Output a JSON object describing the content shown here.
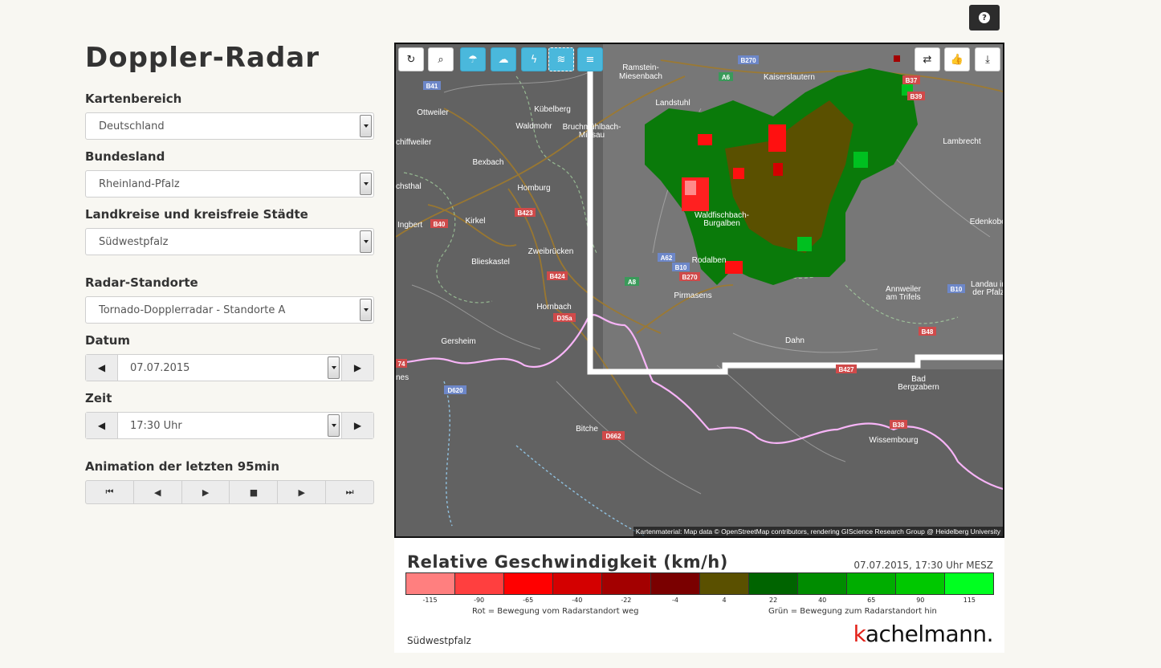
{
  "page": {
    "title": "Doppler-Radar"
  },
  "filters": {
    "kartenbereich": {
      "label": "Kartenbereich",
      "value": "Deutschland"
    },
    "bundesland": {
      "label": "Bundesland",
      "value": "Rheinland-Pfalz"
    },
    "landkreis": {
      "label": "Landkreise und kreisfreie Städte",
      "value": "Südwestpfalz"
    },
    "radar": {
      "label": "Radar-Standorte",
      "value": "Tornado-Dopplerradar - Standorte A"
    },
    "datum": {
      "label": "Datum",
      "value": "07.07.2015"
    },
    "zeit": {
      "label": "Zeit",
      "value": "17:30 Uhr"
    }
  },
  "animation": {
    "label": "Animation der letzten 95min",
    "buttons": [
      "first",
      "prev",
      "play",
      "stop",
      "next",
      "last"
    ]
  },
  "map": {
    "tools_left": [
      "refresh-icon",
      "zoom-icon",
      "umbrella-icon",
      "hail-icon",
      "lightning-icon",
      "wind-icon",
      "wind-gust-icon"
    ],
    "tools_right": [
      "loop-icon",
      "thumbs-up-icon",
      "download-icon"
    ],
    "attribution": "Kartenmaterial: Map data © OpenStreetMap contributors, rendering GIScience Research Group @ Heidelberg University",
    "places": [
      "Ramstein-Miesenbach",
      "Kaiserslautern",
      "Landstuhl",
      "Ottweiler",
      "Kübelberg",
      "Waldmohr",
      "Bruchmühlbach-Miesau",
      "chiffweiler",
      "Bexbach",
      "Homburg",
      "chsthal",
      "Ingbert",
      "Kirkel",
      "Blieskastel",
      "Zweibrücken",
      "Hornbach",
      "Gersheim",
      "nes",
      "Lambrecht",
      "Waldfischbach-Burgalben",
      "Rodalben",
      "Pirmasens",
      "Annweiler am Trifels",
      "Landau in der Pfalz",
      "Edenkoben",
      "Dahn",
      "Bad Bergzabern",
      "Wissembourg",
      "Bitche"
    ],
    "roads": [
      "B270",
      "A6",
      "B41",
      "B37",
      "B39",
      "B40",
      "B423",
      "B424",
      "D35a",
      "A62",
      "B10",
      "B270",
      "A8",
      "B48",
      "B427",
      "D620",
      "D662",
      "B38",
      "B10",
      "74"
    ]
  },
  "legend": {
    "title": "Relative Geschwindigkeit (km/h)",
    "datetime": "07.07.2015, 17:30 Uhr MESZ",
    "colors": [
      "#ff7f7f",
      "#ff3f3f",
      "#ff0000",
      "#d40000",
      "#a30000",
      "#7a0000",
      "#5a5000",
      "#006400",
      "#008c00",
      "#00ad00",
      "#00c800",
      "#00ff20"
    ],
    "ticks": [
      "-115",
      "-90",
      "-65",
      "-40",
      "-22",
      "-4",
      "4",
      "22",
      "40",
      "65",
      "90",
      "115"
    ],
    "note_red": "Rot = Bewegung vom Radarstandort weg",
    "note_green": "Grün = Bewegung zum Radarstandort hin",
    "region": "Südwestpfalz",
    "logo_k": "k",
    "logo_rest": "achelmann."
  }
}
